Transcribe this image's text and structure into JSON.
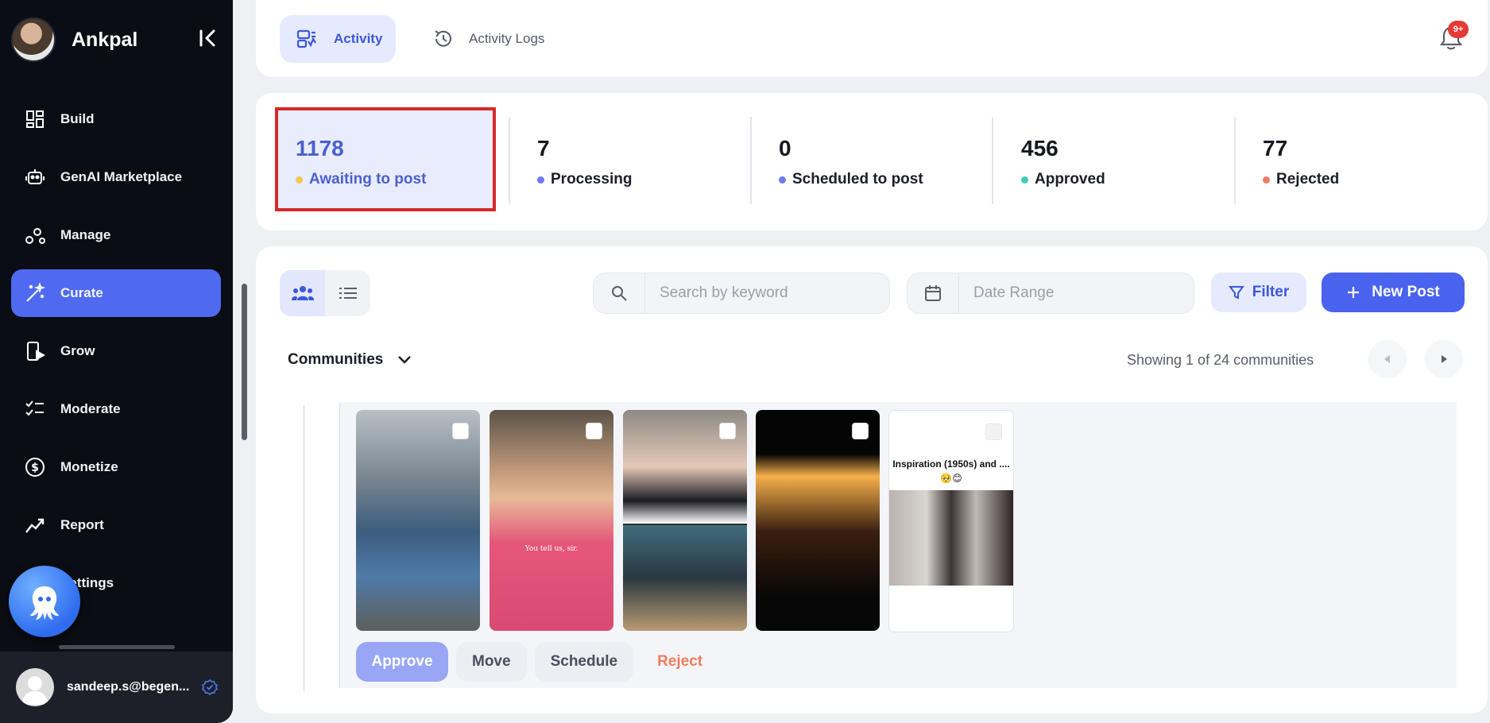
{
  "sidebar": {
    "brand": "Ankpal",
    "items": [
      {
        "label": "Build",
        "icon": "grid-icon"
      },
      {
        "label": "GenAI Marketplace",
        "icon": "robot-icon"
      },
      {
        "label": "Manage",
        "icon": "nodes-icon"
      },
      {
        "label": "Curate",
        "icon": "magic-wand-icon",
        "active": true
      },
      {
        "label": "Grow",
        "icon": "phone-play-icon"
      },
      {
        "label": "Moderate",
        "icon": "checklist-icon"
      },
      {
        "label": "Monetize",
        "icon": "dollar-icon"
      },
      {
        "label": "Report",
        "icon": "trend-icon"
      },
      {
        "label": "Settings",
        "icon": "gear-icon"
      }
    ],
    "user_email": "sandeep.s@begen..."
  },
  "topbar": {
    "tabs": [
      {
        "label": "Activity",
        "active": true
      },
      {
        "label": "Activity Logs",
        "active": false
      }
    ],
    "notification_badge": "9+"
  },
  "stats": [
    {
      "value": "1178",
      "label": "Awaiting to post",
      "color": "#f2c94c",
      "highlight": true
    },
    {
      "value": "7",
      "label": "Processing",
      "color": "#6c7cf0"
    },
    {
      "value": "0",
      "label": "Scheduled to post",
      "color": "#6c7cf0"
    },
    {
      "value": "456",
      "label": "Approved",
      "color": "#3ecfb3"
    },
    {
      "value": "77",
      "label": "Rejected",
      "color": "#f27a6a"
    }
  ],
  "toolbar": {
    "search_placeholder": "Search by keyword",
    "date_placeholder": "Date Range",
    "filter_label": "Filter",
    "new_post_label": "New Post"
  },
  "communities": {
    "selector_label": "Communities",
    "showing_text": "Showing 1 of 24 communities"
  },
  "posts": [
    {
      "thumb": "avatar-crew-selfie"
    },
    {
      "thumb": "man-pink-hoodie",
      "caption": "You tell us, sir."
    },
    {
      "thumb": "drama-split-frame"
    },
    {
      "thumb": "sunset-dance"
    },
    {
      "thumb": "inspiration-1950s",
      "caption": "Inspiration (1950s) and .... 🥺😊"
    }
  ],
  "actions": {
    "approve": "Approve",
    "move": "Move",
    "schedule": "Schedule",
    "reject": "Reject"
  }
}
